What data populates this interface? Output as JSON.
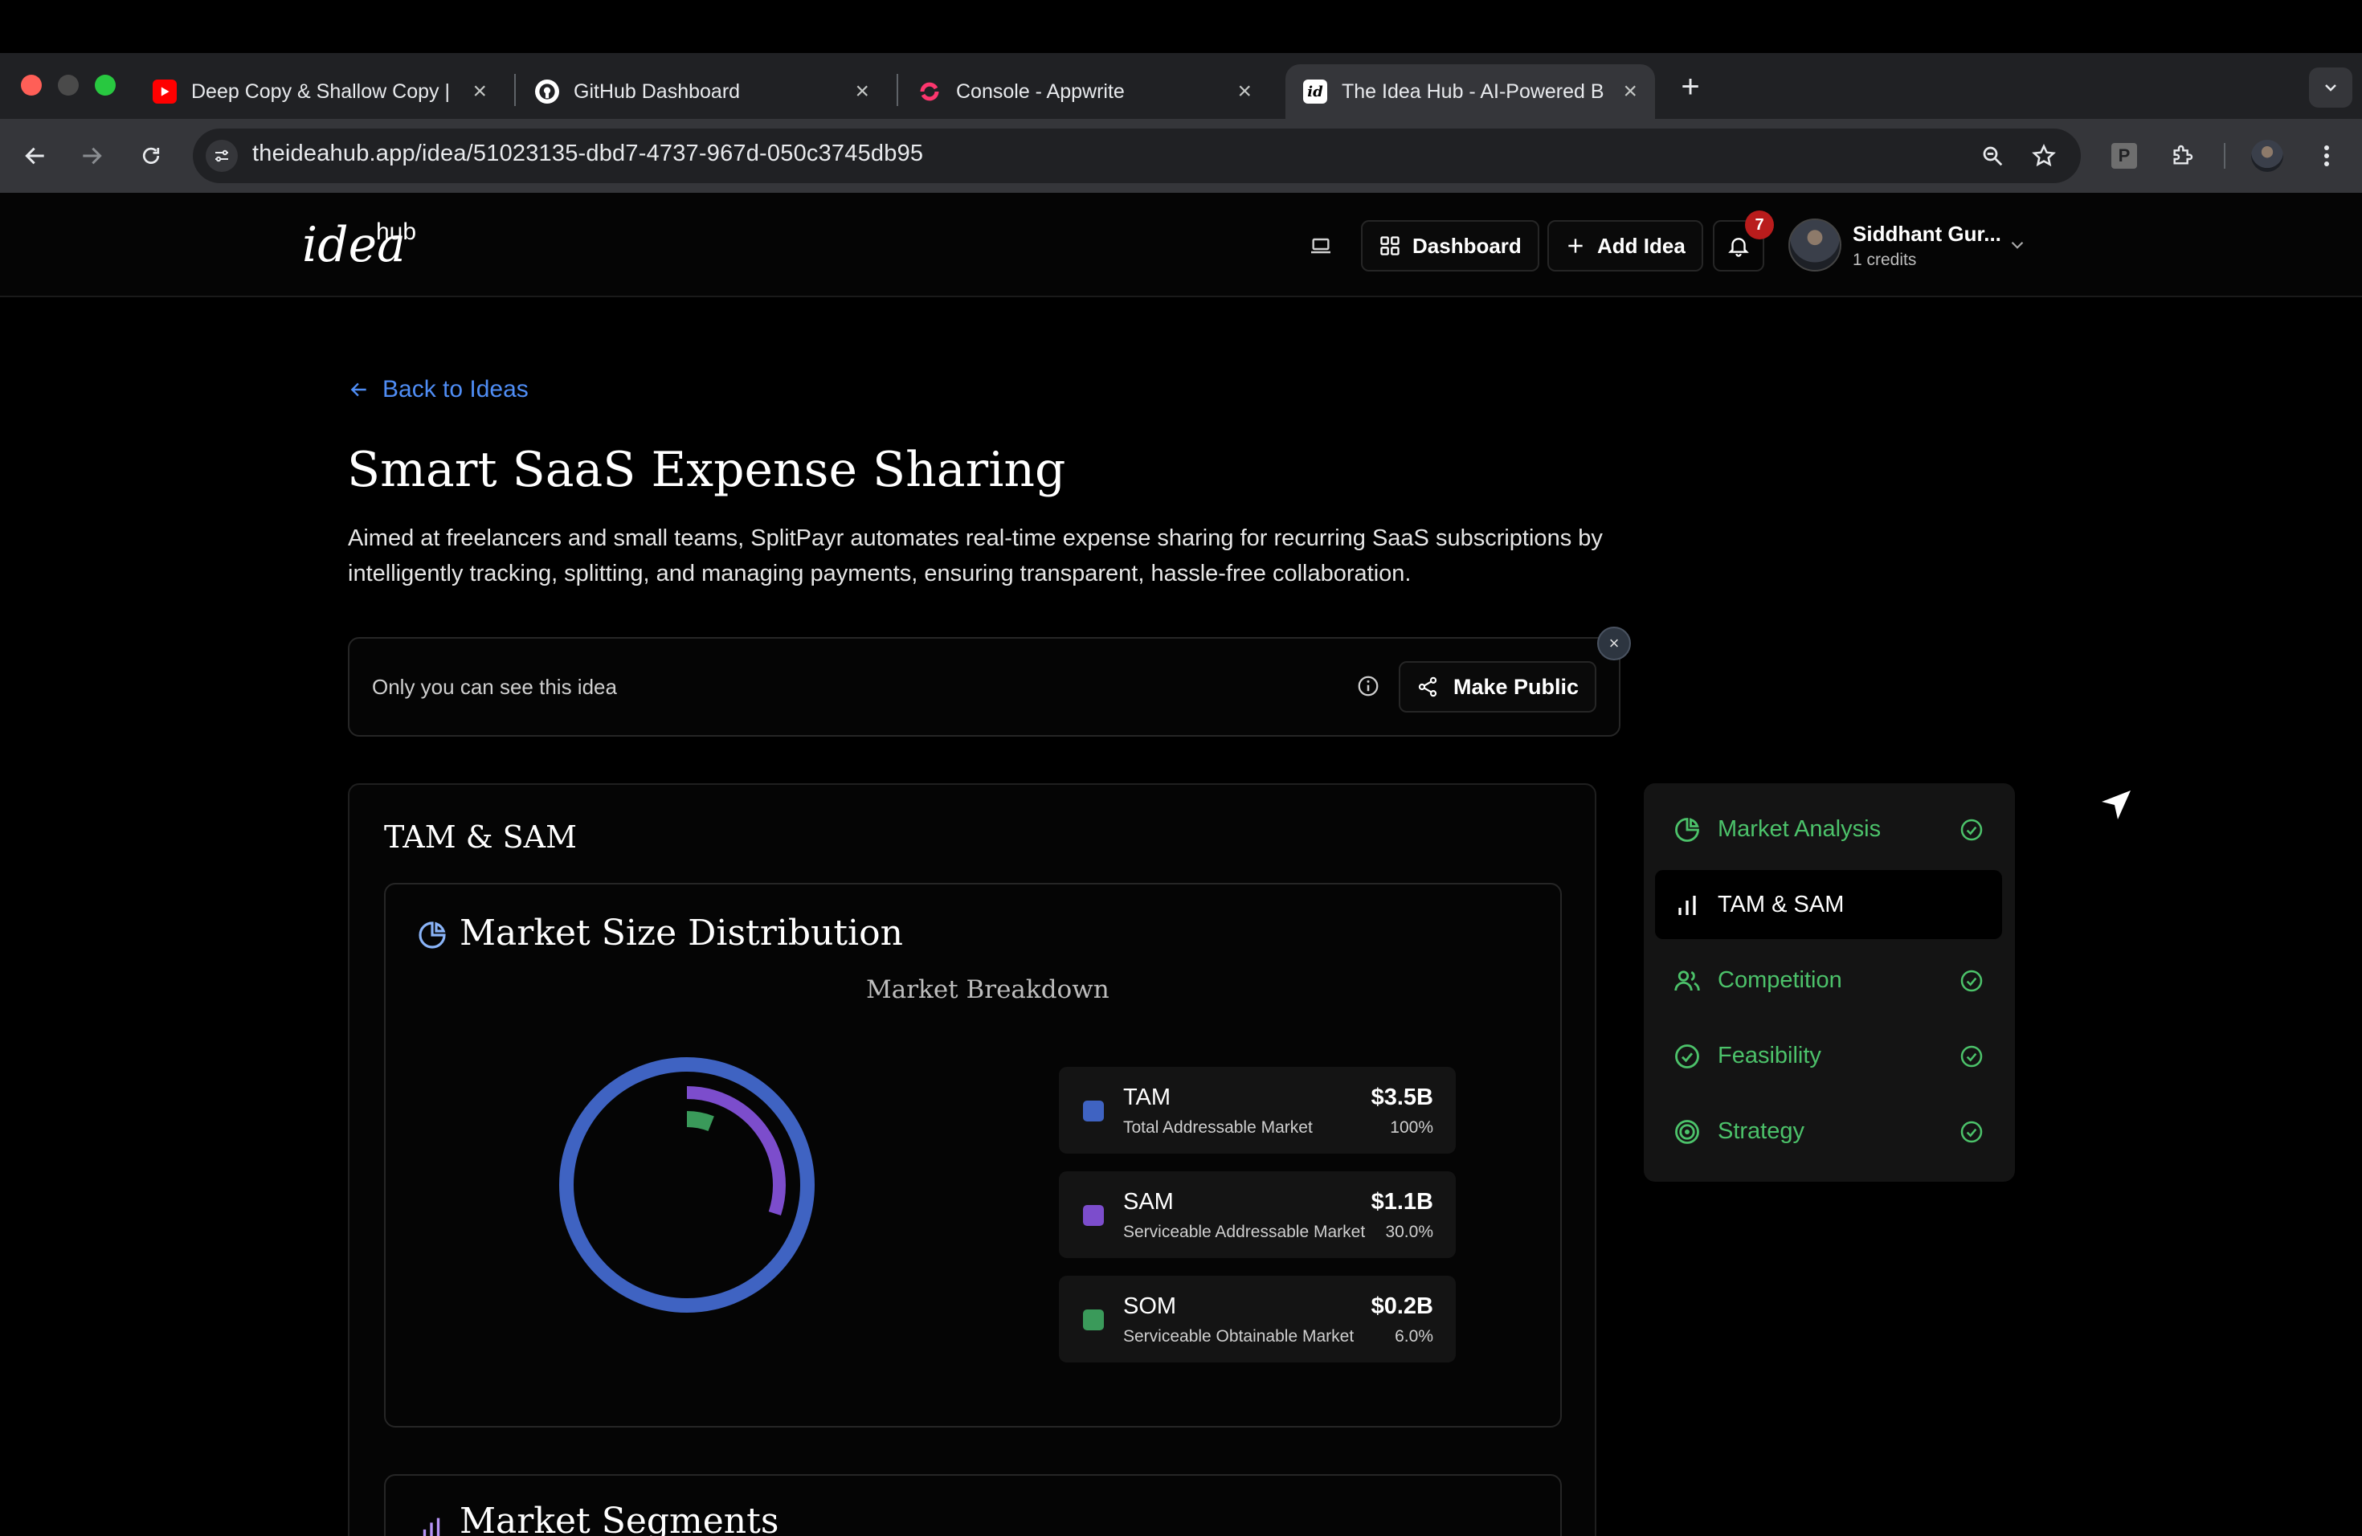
{
  "browser": {
    "tabs": [
      {
        "title": "Deep Copy & Shallow Copy | ",
        "favicon": "youtube-icon",
        "active": false
      },
      {
        "title": "GitHub Dashboard",
        "favicon": "github-icon",
        "active": false
      },
      {
        "title": "Console - Appwrite",
        "favicon": "appwrite-icon",
        "active": false
      },
      {
        "title": "The Idea Hub - AI-Powered B",
        "favicon": "ideahub-icon",
        "active": true
      }
    ],
    "url": "theideahub.app/idea/51023135-dbd7-4737-967d-050c3745db95"
  },
  "app": {
    "logo_text": "idea",
    "logo_sup": "hub",
    "dashboard_label": "Dashboard",
    "add_idea_label": "Add Idea",
    "notification_count": "7",
    "user_name": "Siddhant Gur...",
    "user_credits": "1 credits"
  },
  "page": {
    "back_label": "Back to Ideas",
    "title": "Smart SaaS Expense Sharing",
    "description": "Aimed at freelancers and small teams, SplitPayr automates real-time expense sharing for recurring SaaS subscriptions by intelligently tracking, splitting, and managing payments, ensuring transparent, hassle-free collaboration.",
    "visibility_text": "Only you can see this idea",
    "make_public_label": "Make Public",
    "section_title": "TAM & SAM",
    "market_card_title": "Market Size Distribution",
    "segments_card_title": "Market Segments"
  },
  "chart_data": {
    "type": "pie",
    "title": "Market Breakdown",
    "series": [
      {
        "name": "TAM",
        "label": "Total Addressable Market",
        "value_label": "$3.5B",
        "value": 3.5,
        "percent_label": "100%",
        "percent": 100,
        "color": "#3f63c2"
      },
      {
        "name": "SAM",
        "label": "Serviceable Addressable Market",
        "value_label": "$1.1B",
        "value": 1.1,
        "percent_label": "30.0%",
        "percent": 30.0,
        "color": "#7c4dcc"
      },
      {
        "name": "SOM",
        "label": "Serviceable Obtainable Market",
        "value_label": "$0.2B",
        "value": 0.2,
        "percent_label": "6.0%",
        "percent": 6.0,
        "color": "#3a9a5a"
      }
    ]
  },
  "sidenav": {
    "items": [
      {
        "label": "Market Analysis",
        "icon": "pie-chart-icon",
        "done": true,
        "active": false
      },
      {
        "label": "TAM & SAM",
        "icon": "bar-chart-icon",
        "done": false,
        "active": true
      },
      {
        "label": "Competition",
        "icon": "users-icon",
        "done": true,
        "active": false
      },
      {
        "label": "Feasibility",
        "icon": "check-circle-icon",
        "done": true,
        "active": false
      },
      {
        "label": "Strategy",
        "icon": "target-icon",
        "done": true,
        "active": false
      }
    ]
  },
  "colors": {
    "accent_link": "#4f8df5",
    "nav_green": "#4cc26a",
    "badge_red": "#b91c1c"
  }
}
